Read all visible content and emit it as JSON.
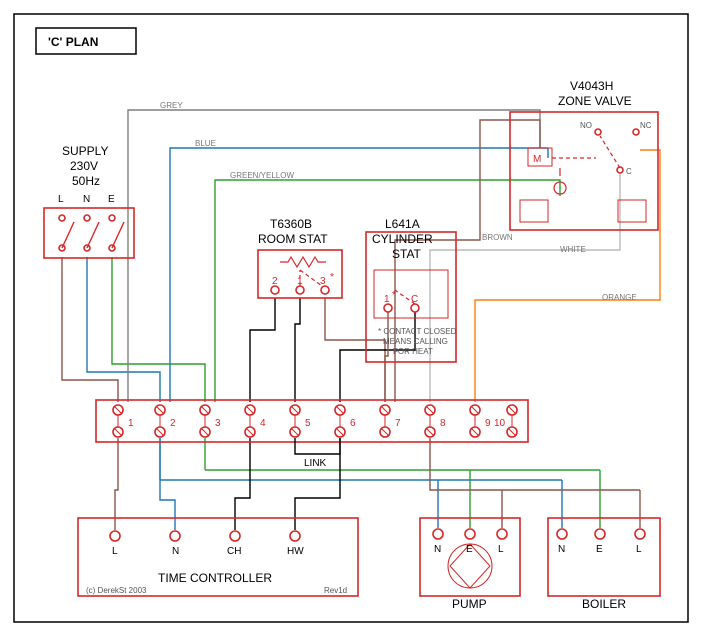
{
  "title": "'C' PLAN",
  "supply": {
    "label": "SUPPLY",
    "voltage": "230V",
    "freq": "50Hz",
    "legs": [
      "L",
      "N",
      "E"
    ]
  },
  "room_stat": {
    "model": "T6360B",
    "name": "ROOM STAT",
    "pins": [
      "2",
      "1",
      "3"
    ],
    "pin3_star": "*"
  },
  "cylinder_stat": {
    "model": "L641A",
    "name": "CYLINDER",
    "name2": "STAT",
    "pins": [
      "1",
      "C"
    ],
    "pin1_star": "*",
    "note1": "* CONTACT CLOSED",
    "note2": "MEANS CALLING",
    "note3": "FOR HEAT"
  },
  "zone_valve": {
    "model": "V4043H",
    "name": "ZONE VALVE",
    "pins": [
      "NO",
      "NC",
      "C"
    ],
    "motor": "M"
  },
  "junction": {
    "link_label": "LINK",
    "terminals": [
      "1",
      "2",
      "3",
      "4",
      "5",
      "6",
      "7",
      "8",
      "9",
      "10"
    ]
  },
  "time_controller": {
    "name": "TIME CONTROLLER",
    "pins": [
      "L",
      "N",
      "CH",
      "HW"
    ],
    "rev": "Rev1d",
    "copyright": "(c) DerekSt 2003"
  },
  "pump": {
    "name": "PUMP",
    "pins": [
      "N",
      "E",
      "L"
    ]
  },
  "boiler": {
    "name": "BOILER",
    "pins": [
      "N",
      "E",
      "L"
    ]
  },
  "wire_labels": {
    "grey": "GREY",
    "blue": "BLUE",
    "greenyellow": "GREEN/YELLOW",
    "brown": "BROWN",
    "white": "WHITE",
    "orange": "ORANGE"
  }
}
